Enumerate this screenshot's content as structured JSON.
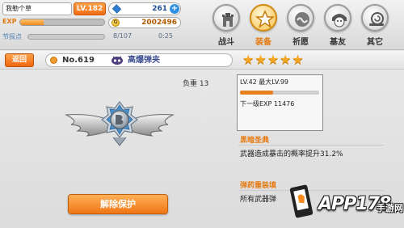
{
  "player": {
    "name": "我勒个草",
    "level": "LV.182",
    "gems": "261",
    "exp_label": "EXP",
    "exp_progress": 0.28,
    "gold": "2002496",
    "search_label": "节探点",
    "search_count": "8/107",
    "search_timer": "0:25"
  },
  "nav": [
    {
      "label": "战斗",
      "icon": "battle-tower-icon",
      "active": false
    },
    {
      "label": "装备",
      "icon": "equipment-star-icon",
      "active": true
    },
    {
      "label": "祈愿",
      "icon": "prayer-icon",
      "active": false
    },
    {
      "label": "基友",
      "icon": "friends-icon",
      "active": false
    },
    {
      "label": "其它",
      "icon": "other-snail-icon",
      "active": false
    }
  ],
  "title_bar": {
    "back_label": "返回",
    "item_number": "No.619",
    "item_name": "高爆弹夹",
    "stars": 5
  },
  "item": {
    "weight": "负重 13",
    "level_text": "LV.42 最大LV.99",
    "level_progress": 0.42,
    "next_exp": "下一级EXP 11476",
    "skill1_title": "黑暗圣典",
    "skill1_desc": "武器造成暴击的概率提升31.2%",
    "skill2_title": "弹药重装填",
    "skill2_desc": "所有武器弹",
    "unlock_label": "解除保护"
  },
  "watermark": {
    "text": "APP178",
    "sub": "手游网"
  },
  "colors": {
    "accent_orange": "#f07615",
    "title_blue": "#3e4f92",
    "star": "#f5a623"
  }
}
